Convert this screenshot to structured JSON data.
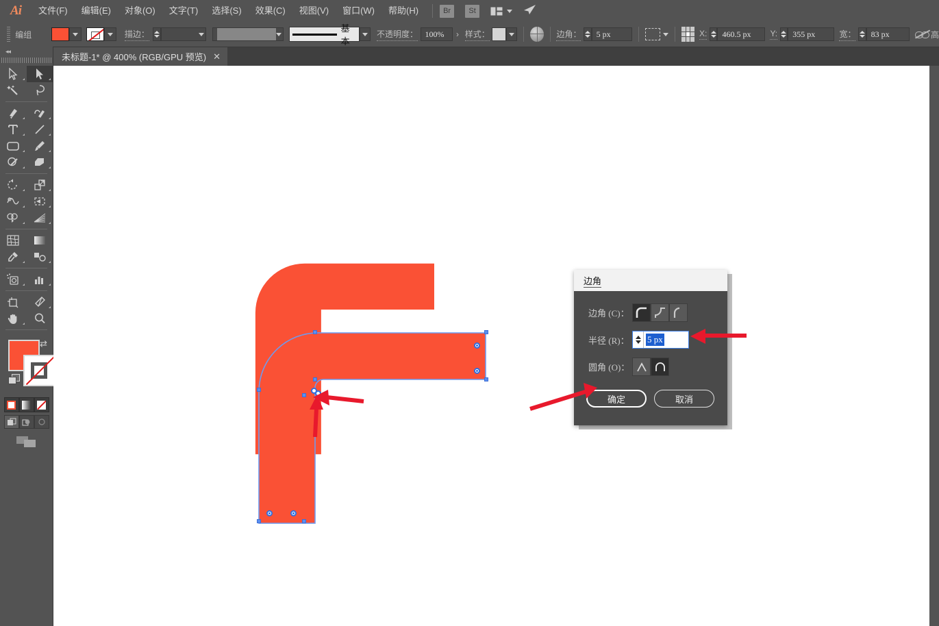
{
  "app": {
    "name": "Adobe Illustrator",
    "logo": "Ai"
  },
  "menubar": {
    "items": [
      {
        "label": "文件(F)",
        "name": "menu-file"
      },
      {
        "label": "编辑(E)",
        "name": "menu-edit"
      },
      {
        "label": "对象(O)",
        "name": "menu-object"
      },
      {
        "label": "文字(T)",
        "name": "menu-type"
      },
      {
        "label": "选择(S)",
        "name": "menu-select"
      },
      {
        "label": "效果(C)",
        "name": "menu-effect"
      },
      {
        "label": "视图(V)",
        "name": "menu-view"
      },
      {
        "label": "窗口(W)",
        "name": "menu-window"
      },
      {
        "label": "帮助(H)",
        "name": "menu-help"
      }
    ],
    "bridge_label": "Br",
    "stock_label": "St",
    "arrange_icon": "arrange-documents-icon",
    "workspace_icon": "workspace-switcher-icon"
  },
  "controlbar": {
    "selection_label": "编组",
    "fill_color": "#fa5135",
    "stroke_color": "none",
    "stroke_label": "描边：",
    "stroke_weight": "",
    "variable_width": "",
    "brush_label": "基本",
    "opacity_label": "不透明度：",
    "opacity_value": "100%",
    "style_label": "样式：",
    "corner_label": "边角：",
    "corner_value": "5 px",
    "transform_x_label": "X:",
    "transform_x_value": "460.5 px",
    "transform_y_label": "Y:",
    "transform_y_value": "355 px",
    "transform_w_label": "宽：",
    "transform_w_value": "83 px",
    "lock_ratio_icon": "unlink-ratio-icon",
    "more_label": "高"
  },
  "tabs": [
    {
      "title": "未标题-1* @ 400% (RGB/GPU 预览)",
      "close": "✕",
      "active": true
    }
  ],
  "toolpanel": {
    "collapse_icon": "collapse-panel-icon",
    "tools": [
      {
        "name": "selection-tool",
        "selected": false
      },
      {
        "name": "direct-selection-tool",
        "selected": true
      },
      {
        "name": "magic-wand-tool",
        "selected": false
      },
      {
        "name": "lasso-tool",
        "selected": false
      },
      {
        "name": "pen-tool",
        "selected": false
      },
      {
        "name": "curvature-tool",
        "selected": false
      },
      {
        "name": "type-tool",
        "selected": false
      },
      {
        "name": "line-segment-tool",
        "selected": false
      },
      {
        "name": "rectangle-tool",
        "selected": false
      },
      {
        "name": "paintbrush-tool",
        "selected": false
      },
      {
        "name": "shaper-tool",
        "selected": false
      },
      {
        "name": "eraser-tool",
        "selected": false
      },
      {
        "name": "rotate-tool",
        "selected": false
      },
      {
        "name": "scale-tool",
        "selected": false
      },
      {
        "name": "width-tool",
        "selected": false
      },
      {
        "name": "free-transform-tool",
        "selected": false
      },
      {
        "name": "shape-builder-tool",
        "selected": false
      },
      {
        "name": "perspective-grid-tool",
        "selected": false
      },
      {
        "name": "mesh-tool",
        "selected": false
      },
      {
        "name": "gradient-tool",
        "selected": false
      },
      {
        "name": "eyedropper-tool",
        "selected": false
      },
      {
        "name": "blend-tool",
        "selected": false
      },
      {
        "name": "symbol-sprayer-tool",
        "selected": false
      },
      {
        "name": "column-graph-tool",
        "selected": false
      },
      {
        "name": "artboard-tool",
        "selected": false
      },
      {
        "name": "slice-tool",
        "selected": false
      },
      {
        "name": "hand-tool",
        "selected": false
      },
      {
        "name": "zoom-tool",
        "selected": false
      }
    ],
    "fill_color": "#fa5135",
    "stroke_color": "none",
    "swap_icon": "swap-fill-stroke-icon",
    "default_icon": "default-fill-stroke-icon",
    "modes": [
      {
        "name": "color-mode",
        "selected": false
      },
      {
        "name": "gradient-mode",
        "selected": false
      },
      {
        "name": "none-mode",
        "selected": true
      }
    ],
    "draw_modes": [
      {
        "name": "draw-normal-mode",
        "selected": true
      },
      {
        "name": "draw-behind-mode",
        "selected": false
      },
      {
        "name": "draw-inside-mode",
        "selected": false
      }
    ],
    "screen_mode_icon": "change-screen-mode-icon"
  },
  "canvas": {
    "shape": {
      "name": "rounded-l-shape",
      "fill": "#fa5135",
      "selection_color": "#6f9aee",
      "corner_widget_name": "live-corner-widget"
    },
    "annotations": [
      {
        "name": "arrow-to-corner-widget-1",
        "color": "#e8192c"
      },
      {
        "name": "arrow-to-corner-widget-2",
        "color": "#e8192c"
      },
      {
        "name": "arrow-to-radius-field",
        "color": "#e8192c"
      },
      {
        "name": "arrow-to-ok-button",
        "color": "#e8192c"
      }
    ]
  },
  "dialog": {
    "title": "边角",
    "corner_label": "边角 (C)：",
    "corner_options": [
      {
        "name": "corner-round-option",
        "selected": true
      },
      {
        "name": "corner-inverted-round-option",
        "selected": false
      },
      {
        "name": "corner-chamfer-option",
        "selected": false
      }
    ],
    "radius_label": "半径 (R)：",
    "radius_value": "5 px",
    "radius_selected": true,
    "rounding_label": "圆角 (O)：",
    "rounding_options": [
      {
        "name": "rounding-absolute-option",
        "selected": false
      },
      {
        "name": "rounding-relative-option",
        "selected": true
      }
    ],
    "ok_label": "确定",
    "cancel_label": "取消"
  }
}
